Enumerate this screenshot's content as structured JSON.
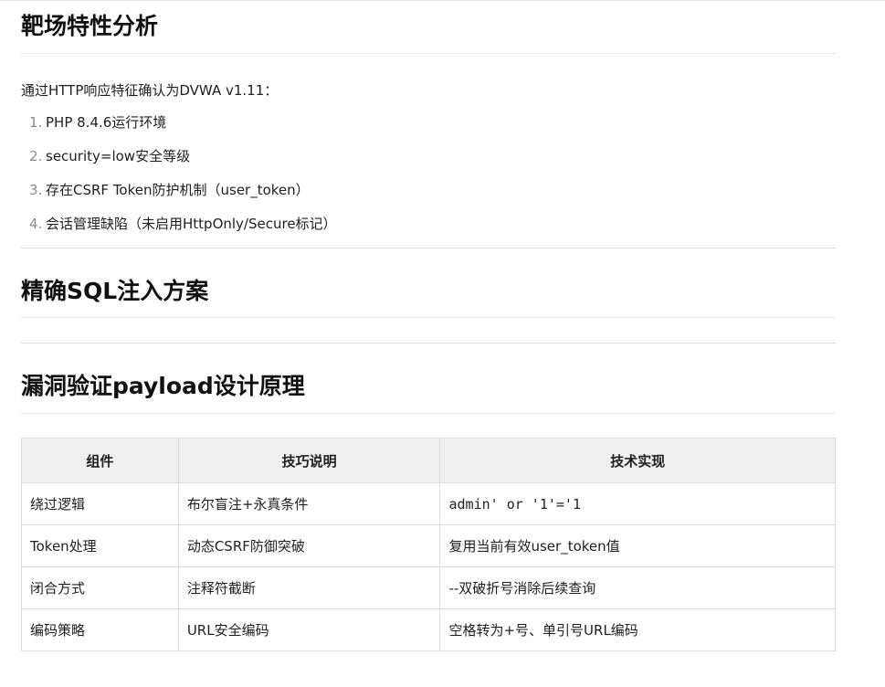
{
  "section1": {
    "title": "靶场特性分析",
    "intro": "通过HTTP响应特征确认为DVWA v1.11：",
    "items": [
      {
        "num": "1.",
        "text": "PHP 8.4.6运行环境"
      },
      {
        "num": "2.",
        "text": "security=low安全等级"
      },
      {
        "num": "3.",
        "text": "存在CSRF Token防护机制（user_token）"
      },
      {
        "num": "4.",
        "text": "会话管理缺陷（未启用HttpOnly/Secure标记）"
      }
    ]
  },
  "section2": {
    "title": "精确SQL注入方案"
  },
  "section3": {
    "title": "漏洞验证payload设计原理",
    "table": {
      "headers": [
        "组件",
        "技巧说明",
        "技术实现"
      ],
      "rows": [
        [
          "绕过逻辑",
          "布尔盲注+永真条件",
          "admin' or '1'='1"
        ],
        [
          "Token处理",
          "动态CSRF防御突破",
          "复用当前有效user_token值"
        ],
        [
          "闭合方式",
          "注释符截断",
          "--双破折号消除后续查询"
        ],
        [
          "编码策略",
          "URL安全编码",
          "空格转为+号、单引号URL编码"
        ]
      ]
    }
  }
}
